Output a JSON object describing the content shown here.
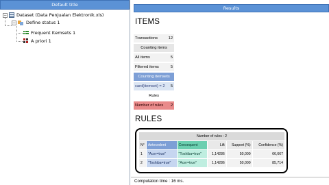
{
  "left_panel": {
    "title": "Default title",
    "tree": [
      {
        "label": "Dataset (Data Penjualan Elektronik.xls)",
        "icon": "dataset-icon",
        "expander": "−"
      },
      {
        "label": "Define status 1",
        "icon": "define-status-icon",
        "expander": "−"
      },
      {
        "label": "Frequent Itemsets 1",
        "icon": "frequent-itemsets-icon"
      },
      {
        "label": "A priori 1",
        "icon": "apriori-icon"
      }
    ]
  },
  "results": {
    "title": "Results",
    "items_heading": "ITEMS",
    "summary": {
      "transactions_label": "Transactions",
      "transactions_value": "12",
      "counting_items_header": "Counting items",
      "all_items_label": "All items",
      "all_items_value": "5",
      "filtered_items_label": "Filtered items",
      "filtered_items_value": "5",
      "counting_itemsets_header": "Counting itemsets",
      "card_label": "card(itemset) = 2",
      "card_value": "5",
      "rules_header": "Rules",
      "number_of_rules_label": "Number of rules",
      "number_of_rules_value": "2"
    },
    "rules_heading": "RULES",
    "rules_table": {
      "caption": "Number of rules : 2",
      "headers": [
        "N°",
        "Antecedent",
        "Consequent",
        "Lift",
        "Support (%)",
        "Confidence (%)"
      ],
      "rows": [
        [
          "1",
          "\"Acer=true\"",
          "\"Toshiba=true\"",
          "1,14286",
          "50,000",
          "66,667"
        ],
        [
          "2",
          "\"Toshiba=true\"",
          "\"Acer=true\"",
          "1,14286",
          "50,000",
          "85,714"
        ]
      ]
    }
  },
  "status": {
    "computation_time": "Computation time : 16 ms."
  },
  "colors": {
    "title_bar": "#5b92d6",
    "antecedent_header": "#7d9fd6",
    "consequent_header": "#6ccfb0",
    "rules_highlight": "#e98a8a"
  }
}
